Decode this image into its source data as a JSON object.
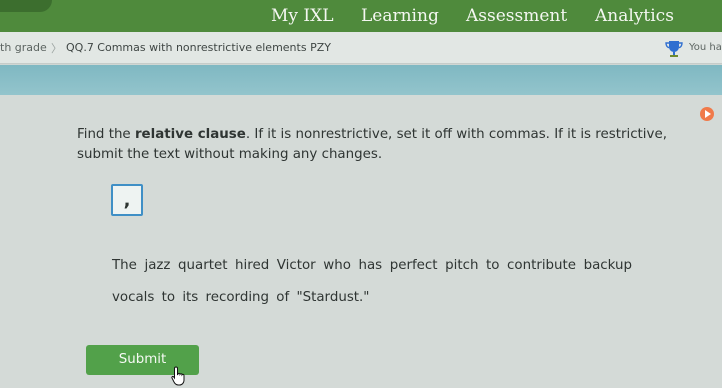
{
  "nav": {
    "items": [
      "My IXL",
      "Learning",
      "Assessment",
      "Analytics"
    ]
  },
  "breadcrumb": {
    "grade": "th grade",
    "separator": "〉",
    "skill": "QQ.7 Commas with nonrestrictive elements PZY",
    "right_text": "You hav"
  },
  "question": {
    "instruction_pre": "Find the ",
    "instruction_bold": "relative clause",
    "instruction_post": ". If it is nonrestrictive, set it off with commas. If it is restrictive, submit the text without making any changes.",
    "comma_tile": ",",
    "sentence_line1": "The jazz quartet hired Victor who has perfect pitch to contribute backup",
    "sentence_line2": "vocals to its recording of \"Stardust.\""
  },
  "submit": {
    "label": "Submit"
  },
  "colors": {
    "nav_bar": "#4f8a3c",
    "teal_band": "#8ac0c8",
    "submit_button": "#52a14a",
    "tile_border": "#3f8fc6",
    "play_badge": "#f07a4a"
  },
  "icons": [
    "trophy-icon",
    "play-icon",
    "hand-cursor-icon"
  ]
}
